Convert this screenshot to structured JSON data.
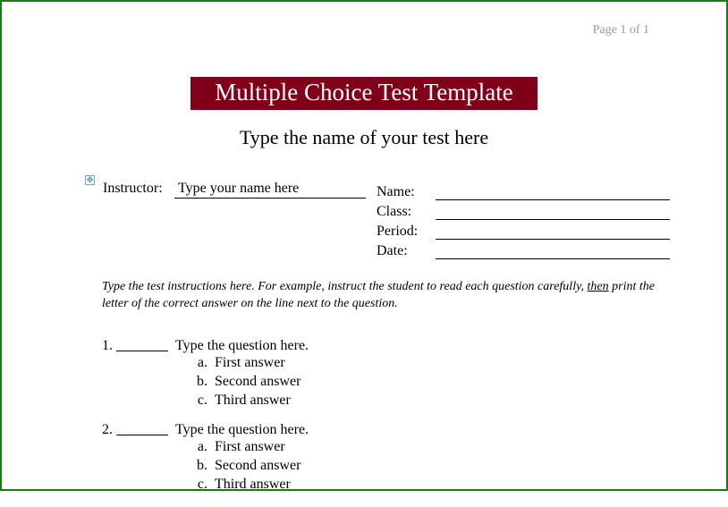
{
  "header": {
    "page_number": "Page 1 of 1"
  },
  "title": "Multiple Choice Test Template",
  "subtitle": "Type the name of your test here",
  "form": {
    "instructor_label": "Instructor:",
    "instructor_placeholder": "Type your name here",
    "fields": [
      {
        "label": "Name:"
      },
      {
        "label": "Class:"
      },
      {
        "label": "Period:"
      },
      {
        "label": "Date:"
      }
    ]
  },
  "instructions": {
    "part1": "Type the test instructions here.  For example, instruct the student to read each question carefully, ",
    "underlined": "then",
    "part2": " print the letter of the correct answer on the line next to the question."
  },
  "questions": [
    {
      "number": "1.",
      "prompt": "Type the question here.",
      "answers": [
        {
          "letter": "a.",
          "text": "First answer"
        },
        {
          "letter": "b.",
          "text": "Second answer"
        },
        {
          "letter": "c.",
          "text": "Third answer"
        }
      ]
    },
    {
      "number": "2.",
      "prompt": "Type the question here.",
      "answers": [
        {
          "letter": "a.",
          "text": "First answer"
        },
        {
          "letter": "b.",
          "text": "Second answer"
        },
        {
          "letter": "c.",
          "text": "Third answer"
        }
      ]
    }
  ]
}
